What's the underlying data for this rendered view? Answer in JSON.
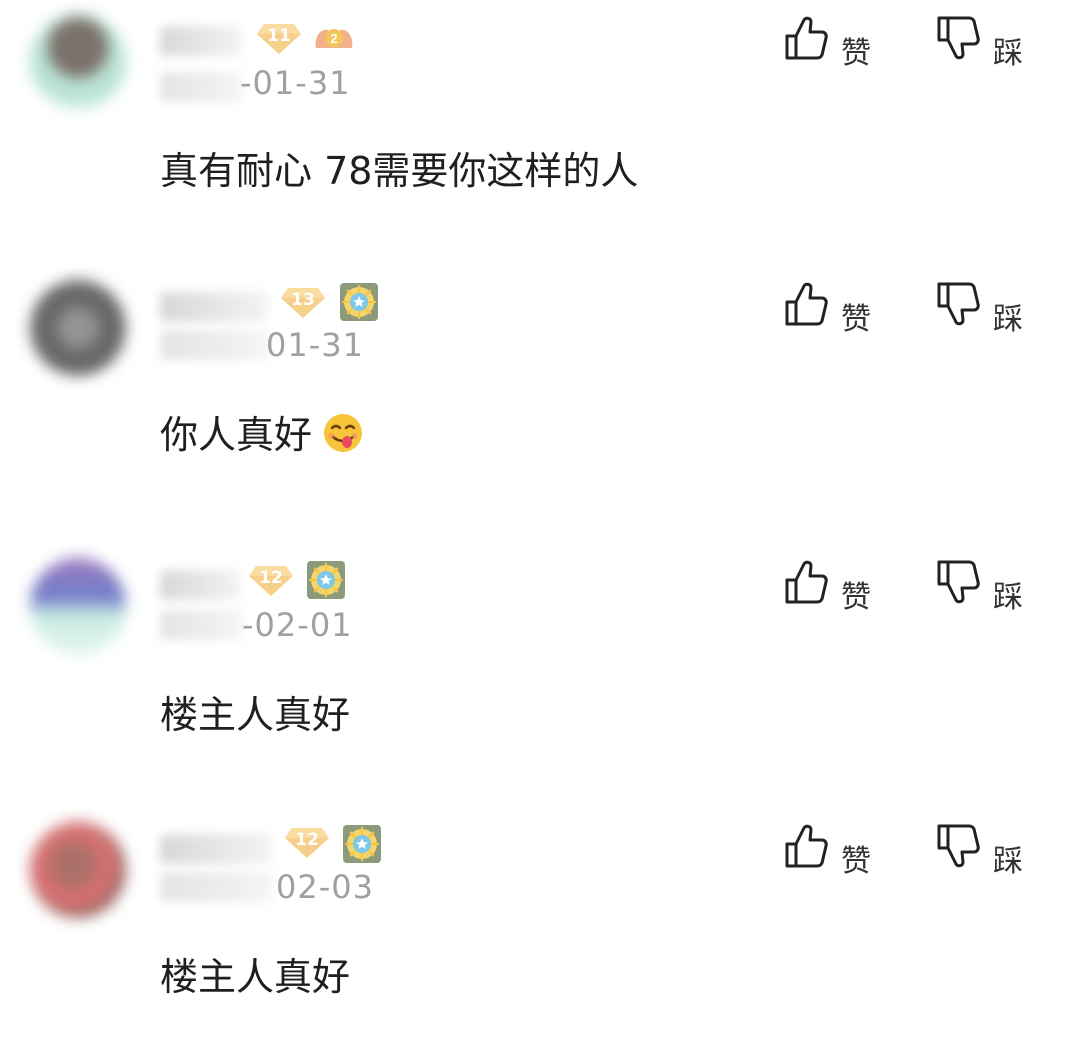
{
  "actions": {
    "like_label": "赞",
    "dislike_label": "踩"
  },
  "comments": [
    {
      "date_visible": "-01-31",
      "level": "11",
      "content": "真有耐心 78需要你这样的人",
      "badge": "gift-badge"
    },
    {
      "date_visible": "01-31",
      "level": "13",
      "content": "你人真好",
      "badge": "medal-badge",
      "emoji": "yum-face-emoji"
    },
    {
      "date_visible": "-02-01",
      "level": "12",
      "content": "楼主人真好",
      "badge": "medal-badge"
    },
    {
      "date_visible": "02-03",
      "level": "12",
      "content": "楼主人真好",
      "badge": "medal-badge"
    }
  ],
  "colors": {
    "level_badge": "#f6d08a",
    "date_text": "#a0a0a0"
  }
}
